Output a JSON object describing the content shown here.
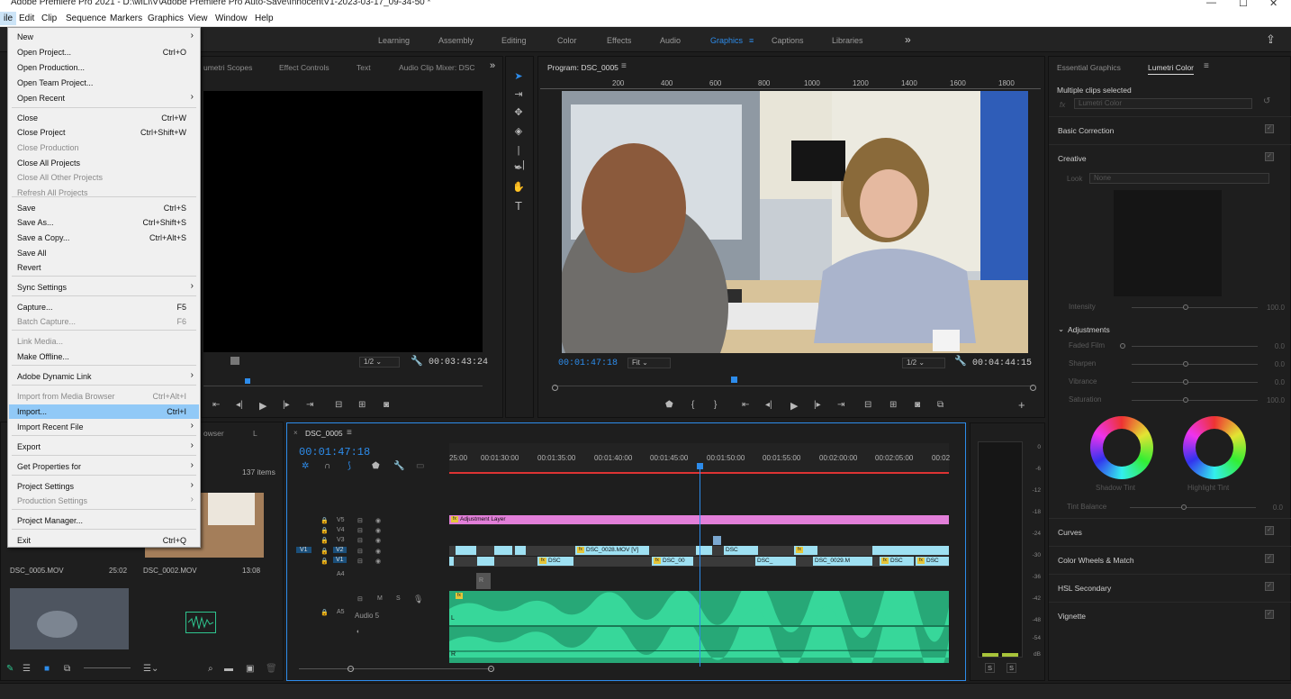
{
  "window": {
    "title": "Adobe Premiere Pro 2021 - D:\\wiLl\\V\\Adobe Premiere Pro Auto-Save\\InnocentV1-2023-03-17_09-34-50 *",
    "minimize_glyph": "—",
    "maximize_glyph": "☐",
    "close_glyph": "✕"
  },
  "menubar": [
    "ile",
    "Edit",
    "Clip",
    "Sequence",
    "Markers",
    "Graphics",
    "View",
    "Window",
    "Help"
  ],
  "workspaces": {
    "items": [
      "Learning",
      "Assembly",
      "Editing",
      "Color",
      "Effects",
      "Audio",
      "Graphics",
      "Captions",
      "Libraries"
    ],
    "active": "Graphics",
    "more": "»"
  },
  "source_panel": {
    "tabs": [
      "umetri Scopes",
      "Effect Controls",
      "Text",
      "Audio Clip Mixer: DSC"
    ],
    "fraction": "1/2",
    "timecode": "00:03:43:24"
  },
  "program_panel": {
    "title": "Program: DSC_0005",
    "ruler_ticks": [
      "200",
      "400",
      "600",
      "800",
      "1000",
      "1200",
      "1400",
      "1600",
      "1800"
    ],
    "timecode": "00:01:47:18",
    "fit": "Fit",
    "fraction": "1/2",
    "duration": "00:04:44:15"
  },
  "project_panel": {
    "tab1": "owser",
    "tab2": "L",
    "item_count": "137 items",
    "clips": [
      {
        "name": "DSC_0005.MOV",
        "duration": "25:02"
      },
      {
        "name": "DSC_0002.MOV",
        "duration": "13:08"
      }
    ]
  },
  "timeline": {
    "sequence_name": "DSC_0005",
    "timecode": "00:01:47:18",
    "ruler": [
      "25:00",
      "00:01:30:00",
      "00:01:35:00",
      "00:01:40:00",
      "00:01:45:00",
      "00:01:50:00",
      "00:01:55:00",
      "00:02:00:00",
      "00:02:05:00",
      "00:02"
    ],
    "tracks": {
      "video": [
        "V5",
        "V4",
        "V3",
        "V2",
        "V1"
      ],
      "audio_a4": "A4",
      "audio_a5": "A5",
      "audio_name": "Audio 5",
      "source_patch": "V1"
    },
    "clips": {
      "adjustment": "Adjustment Layer",
      "v2_mid": "DSC_0028.MOV [V]",
      "v2_dsc": "DSC",
      "v1_a": "DSC",
      "v1_b": "DSC_00",
      "v1_c": "DSC_",
      "v1_d": "DSC_0029.M",
      "v1_e": "DSC",
      "v1_f": "DSC"
    },
    "audio_letters": {
      "fx": "fx",
      "l": "L",
      "r": "R"
    }
  },
  "meters": {
    "labels": [
      "0",
      "-6",
      "-12",
      "-18",
      "-24",
      "-30",
      "-36",
      "-42",
      "-48",
      "-54",
      "dB"
    ],
    "solo": [
      "S",
      "S"
    ]
  },
  "lumetri": {
    "tabs": [
      "Essential Graphics",
      "Lumetri Color"
    ],
    "active_tab": "Lumetri Color",
    "status": "Multiple clips selected",
    "fx": "fx",
    "effect": "Lumetri Color",
    "sections": [
      "Basic Correction",
      "Creative",
      "Curves",
      "Color Wheels & Match",
      "HSL Secondary",
      "Vignette"
    ],
    "look_label": "Look",
    "look_value": "None",
    "intensity": {
      "label": "Intensity",
      "value": "100.0"
    },
    "adjustments_title": "Adjustments",
    "adjustments": [
      {
        "label": "Faded Film",
        "value": "0.0",
        "pos": 0.0
      },
      {
        "label": "Sharpen",
        "value": "0.0",
        "pos": 0.5
      },
      {
        "label": "Vibrance",
        "value": "0.0",
        "pos": 0.5
      },
      {
        "label": "Saturation",
        "value": "100.0",
        "pos": 0.5
      }
    ],
    "wheels": [
      "Shadow Tint",
      "Highlight Tint"
    ],
    "tint_balance": {
      "label": "Tint Balance",
      "value": "0.0"
    }
  },
  "file_menu": {
    "items": [
      {
        "label": "New",
        "shortcut": "",
        "submenu": true,
        "disabled": false
      },
      {
        "label": "Open Project...",
        "shortcut": "Ctrl+O",
        "submenu": false,
        "disabled": false
      },
      {
        "label": "Open Production...",
        "shortcut": "",
        "submenu": false,
        "disabled": false
      },
      {
        "label": "Open Team Project...",
        "shortcut": "",
        "submenu": false,
        "disabled": false
      },
      {
        "label": "Open Recent",
        "shortcut": "",
        "submenu": true,
        "disabled": false
      },
      {
        "label": "Close",
        "shortcut": "Ctrl+W",
        "submenu": false,
        "disabled": false
      },
      {
        "label": "Close Project",
        "shortcut": "Ctrl+Shift+W",
        "submenu": false,
        "disabled": false
      },
      {
        "label": "Close Production",
        "shortcut": "",
        "submenu": false,
        "disabled": true
      },
      {
        "label": "Close All Projects",
        "shortcut": "",
        "submenu": false,
        "disabled": false
      },
      {
        "label": "Close All Other Projects",
        "shortcut": "",
        "submenu": false,
        "disabled": true
      },
      {
        "label": "Refresh All Projects",
        "shortcut": "",
        "submenu": false,
        "disabled": true
      },
      {
        "label": "Save",
        "shortcut": "Ctrl+S",
        "submenu": false,
        "disabled": false
      },
      {
        "label": "Save As...",
        "shortcut": "Ctrl+Shift+S",
        "submenu": false,
        "disabled": false
      },
      {
        "label": "Save a Copy...",
        "shortcut": "Ctrl+Alt+S",
        "submenu": false,
        "disabled": false
      },
      {
        "label": "Save All",
        "shortcut": "",
        "submenu": false,
        "disabled": false
      },
      {
        "label": "Revert",
        "shortcut": "",
        "submenu": false,
        "disabled": false
      },
      {
        "label": "Sync Settings",
        "shortcut": "",
        "submenu": true,
        "disabled": false
      },
      {
        "label": "Capture...",
        "shortcut": "F5",
        "submenu": false,
        "disabled": false
      },
      {
        "label": "Batch Capture...",
        "shortcut": "F6",
        "submenu": false,
        "disabled": true
      },
      {
        "label": "Link Media...",
        "shortcut": "",
        "submenu": false,
        "disabled": true
      },
      {
        "label": "Make Offline...",
        "shortcut": "",
        "submenu": false,
        "disabled": false
      },
      {
        "label": "Adobe Dynamic Link",
        "shortcut": "",
        "submenu": true,
        "disabled": false
      },
      {
        "label": "Import from Media Browser",
        "shortcut": "Ctrl+Alt+I",
        "submenu": false,
        "disabled": true
      },
      {
        "label": "Import...",
        "shortcut": "Ctrl+I",
        "submenu": false,
        "disabled": false,
        "highlighted": true
      },
      {
        "label": "Import Recent File",
        "shortcut": "",
        "submenu": true,
        "disabled": false
      },
      {
        "label": "Export",
        "shortcut": "",
        "submenu": true,
        "disabled": false
      },
      {
        "label": "Get Properties for",
        "shortcut": "",
        "submenu": true,
        "disabled": false
      },
      {
        "label": "Project Settings",
        "shortcut": "",
        "submenu": true,
        "disabled": false
      },
      {
        "label": "Production Settings",
        "shortcut": "",
        "submenu": true,
        "disabled": true
      },
      {
        "label": "Project Manager...",
        "shortcut": "",
        "submenu": false,
        "disabled": false
      },
      {
        "label": "Exit",
        "shortcut": "Ctrl+Q",
        "submenu": false,
        "disabled": false
      }
    ],
    "submenu_glyph": "›"
  },
  "icons": [
    "selection-tool-icon",
    "track-select-icon",
    "ripple-edit-icon",
    "razor-icon",
    "slip-icon",
    "pen-icon",
    "hand-icon",
    "type-icon",
    "play-icon",
    "step-back-icon",
    "step-forward-icon",
    "camera-icon",
    "marker-icon",
    "wrench-icon",
    "magnet-icon",
    "add-icon",
    "share-icon"
  ],
  "colors": {
    "accent": "#2d8ceb",
    "adjustment_clip": "#e27fd9",
    "video_clip": "#9ee0f2",
    "audio_clip": "#2ec48e",
    "playhead": "#2d8ceb",
    "menu_highlight": "#91c9f7"
  }
}
